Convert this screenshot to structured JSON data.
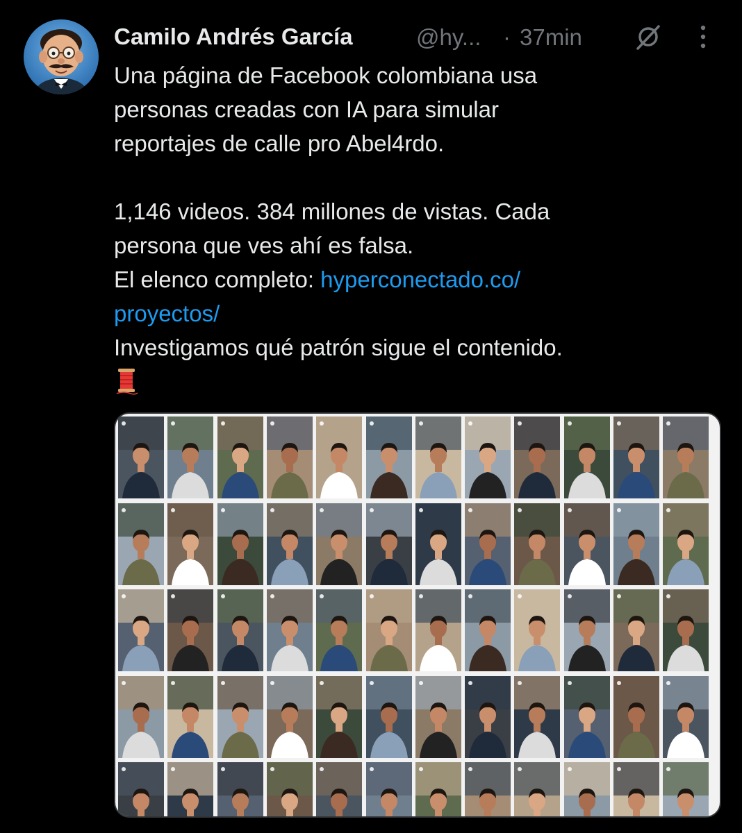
{
  "tweet": {
    "author_name": "Camilo Andrés García",
    "handle": "@hy...",
    "separator": "·",
    "time": "37min",
    "icons": {
      "grok": "grok-slash-icon",
      "more": "vertical-dots-icon",
      "spool": "thread-spool-emoji"
    },
    "lines": [
      "Una página de Facebook colombiana usa",
      "personas creadas con IA para simular",
      "reportajes de calle pro Abel4rdo."
    ],
    "lines2": [
      "1,146 videos. 384 millones de vistas. Cada",
      "persona que ves ahí es falsa."
    ],
    "cast_prefix": "El elenco completo: ",
    "link_part1": "hyperconectado.co/",
    "link_part2": "proyectos/",
    "closing": "Investigamos qué patrón sigue el contenido.",
    "media": {
      "rows": 5,
      "cols": 12,
      "accent": "#1d9bf0"
    }
  }
}
